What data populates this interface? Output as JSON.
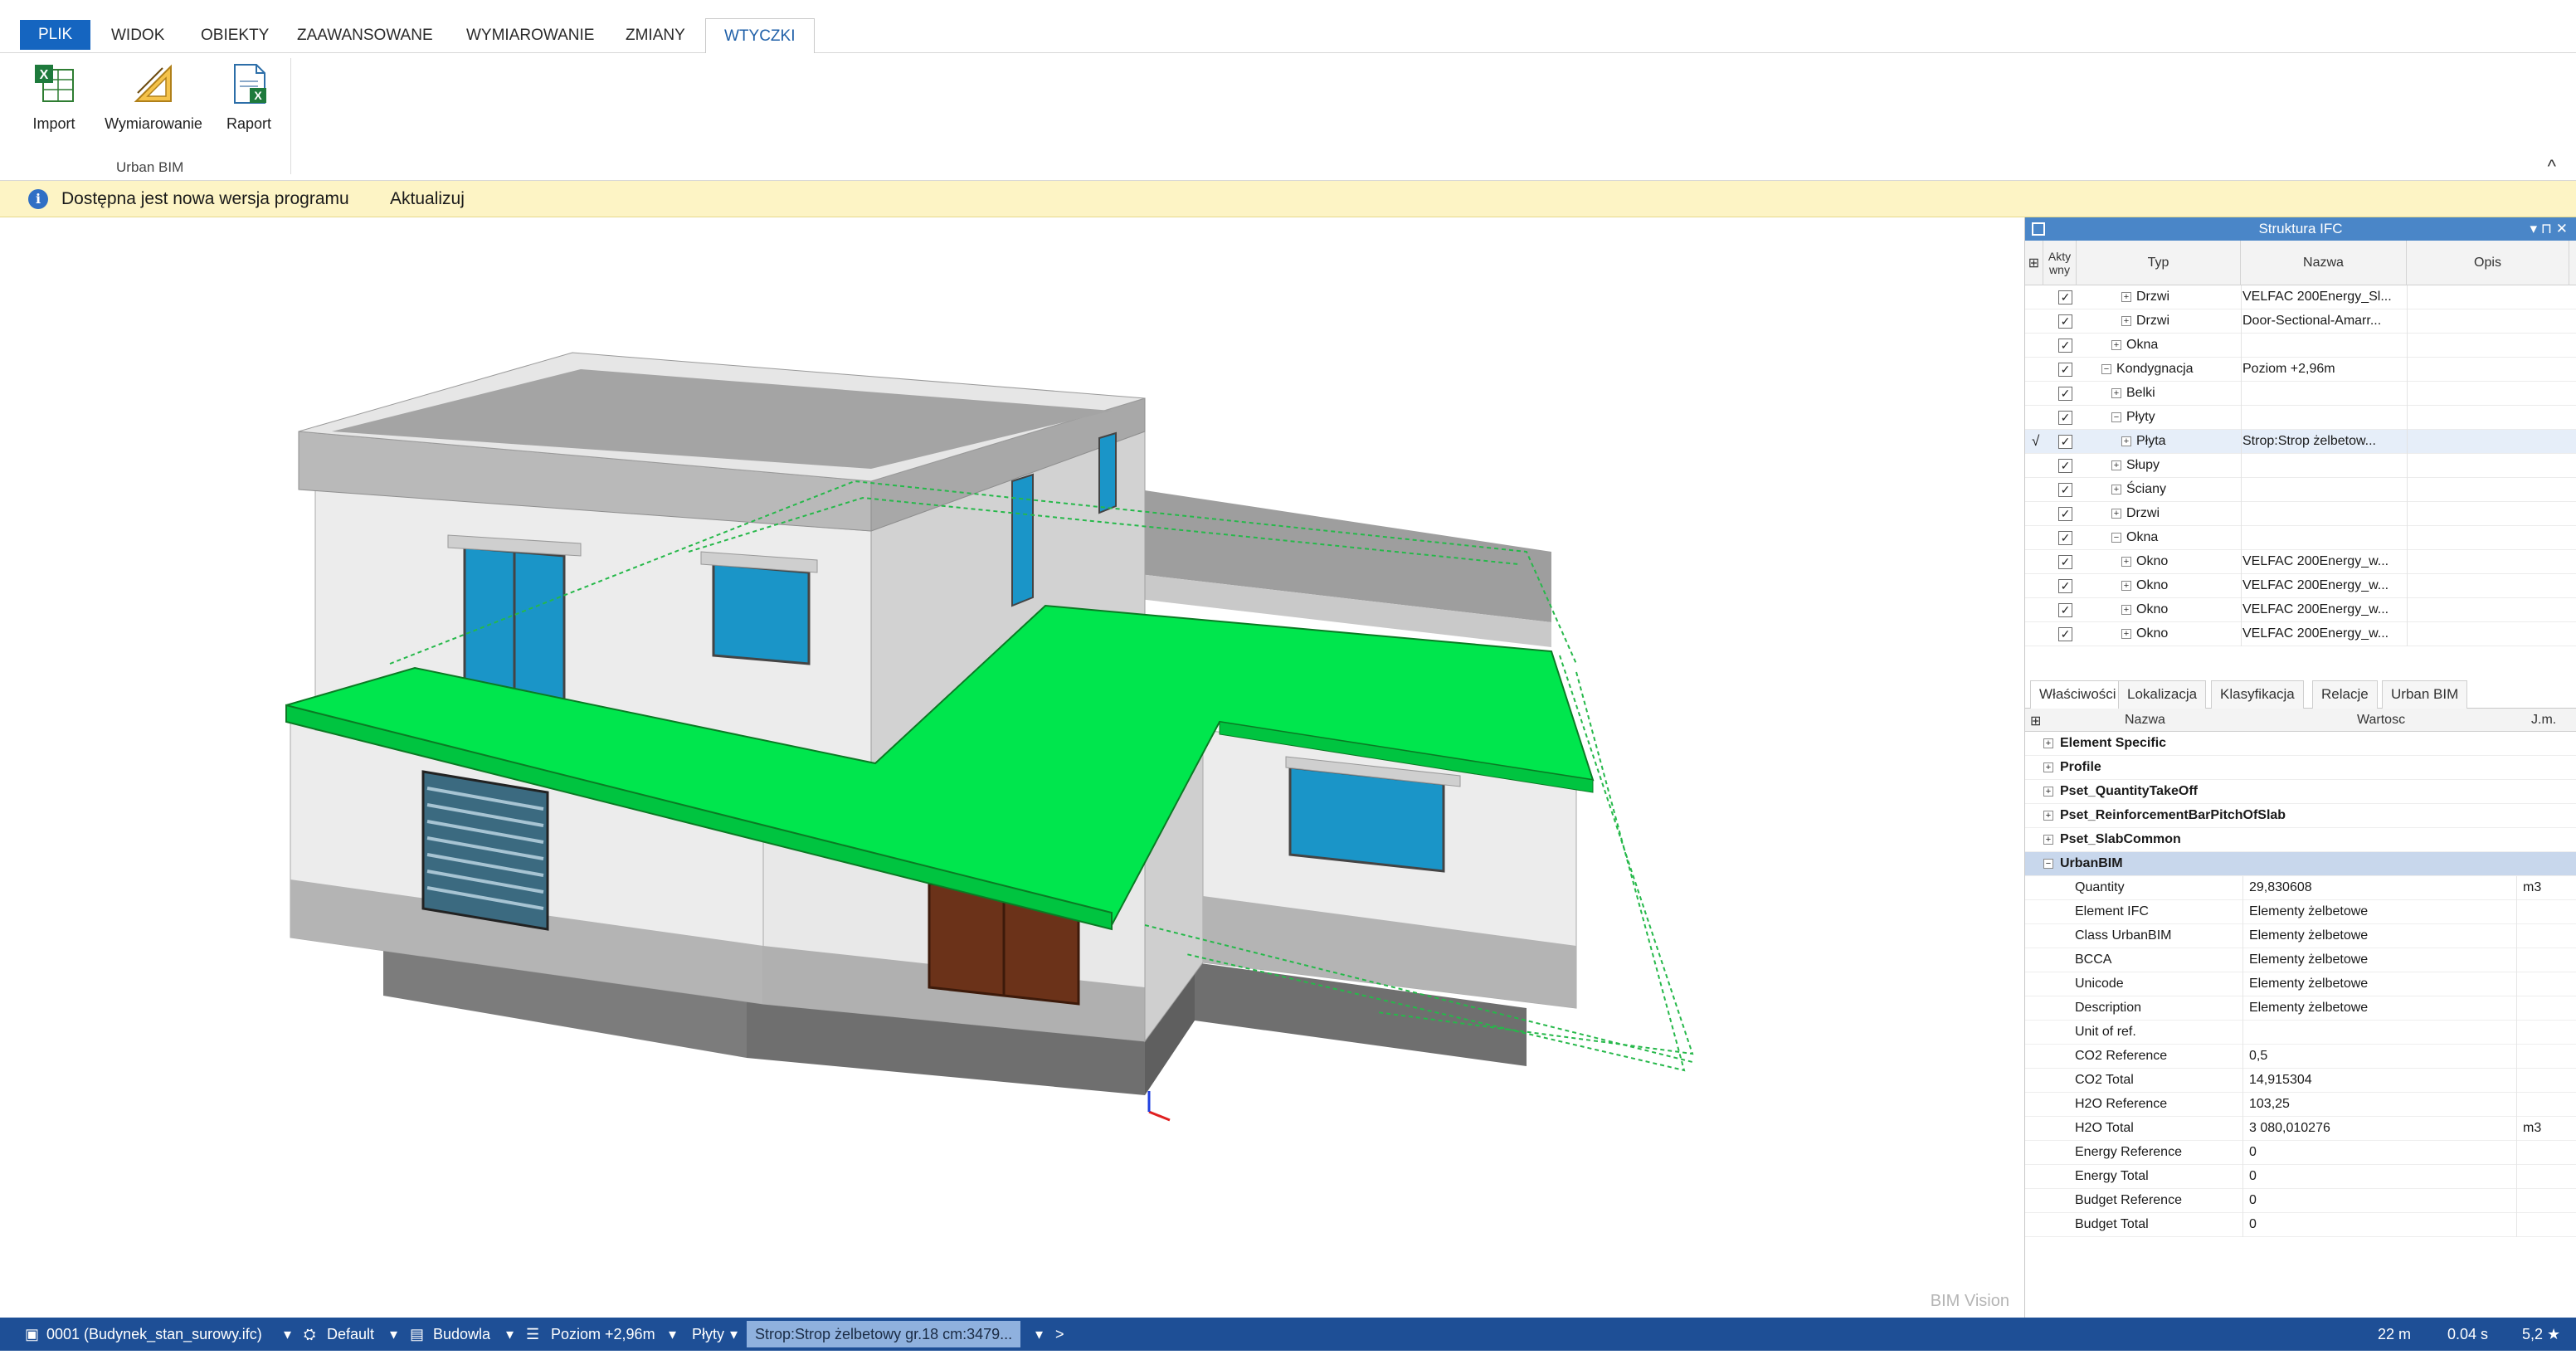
{
  "ribbon": {
    "tabs": [
      "PLIK",
      "WIDOK",
      "OBIEKTY",
      "ZAAWANSOWANE",
      "WYMIAROWANIE",
      "ZMIANY",
      "WTYCZKI"
    ],
    "active_tab": "WTYCZKI",
    "buttons": {
      "import": "Import",
      "dimensioning": "Wymiarowanie",
      "report": "Raport"
    },
    "group_label": "Urban BIM",
    "collapse_glyph": "^"
  },
  "notification": {
    "message": "Dostępna jest nowa wersja programu",
    "action": "Aktualizuj",
    "icon": "info-icon"
  },
  "viewport": {
    "watermark": "BIM Vision",
    "highlight_color": "#00e64d"
  },
  "ifc_panel": {
    "title": "Struktura IFC",
    "columns": {
      "active": "Akty wny",
      "type": "Typ",
      "name": "Nazwa",
      "desc": "Opis"
    },
    "rows": [
      {
        "type": "Drzwi",
        "name": "VELFAC 200Energy_Sl...",
        "level": 3,
        "expander": "+",
        "selected": false
      },
      {
        "type": "Drzwi",
        "name": "Door-Sectional-Amarr...",
        "level": 3,
        "expander": "+",
        "selected": false
      },
      {
        "type": "Okna",
        "name": "",
        "level": 2,
        "expander": "+",
        "selected": false
      },
      {
        "type": "Kondygnacja",
        "name": "Poziom +2,96m",
        "level": 1,
        "expander": "−",
        "selected": false
      },
      {
        "type": "Belki",
        "name": "",
        "level": 2,
        "expander": "+",
        "selected": false
      },
      {
        "type": "Płyty",
        "name": "",
        "level": 2,
        "expander": "−",
        "selected": false
      },
      {
        "type": "Płyta",
        "name": "Strop:Strop żelbetow...",
        "level": 3,
        "expander": "+",
        "selected": true
      },
      {
        "type": "Słupy",
        "name": "",
        "level": 2,
        "expander": "+",
        "selected": false
      },
      {
        "type": "Ściany",
        "name": "",
        "level": 2,
        "expander": "+",
        "selected": false
      },
      {
        "type": "Drzwi",
        "name": "",
        "level": 2,
        "expander": "+",
        "selected": false
      },
      {
        "type": "Okna",
        "name": "",
        "level": 2,
        "expander": "−",
        "selected": false
      },
      {
        "type": "Okno",
        "name": "VELFAC 200Energy_w...",
        "level": 3,
        "expander": "+",
        "selected": false
      },
      {
        "type": "Okno",
        "name": "VELFAC 200Energy_w...",
        "level": 3,
        "expander": "+",
        "selected": false
      },
      {
        "type": "Okno",
        "name": "VELFAC 200Energy_w...",
        "level": 3,
        "expander": "+",
        "selected": false
      },
      {
        "type": "Okno",
        "name": "VELFAC 200Energy_w...",
        "level": 3,
        "expander": "+",
        "selected": false
      }
    ],
    "check_glyph": "✓",
    "selected_marker": "√"
  },
  "props_panel": {
    "tabs": [
      "Właściwości",
      "Lokalizacja",
      "Klasyfikacja",
      "Relacje",
      "Urban BIM"
    ],
    "active_tab": "Właściwości",
    "columns": {
      "name": "Nazwa",
      "value": "Wartosc",
      "unit": "J.m."
    },
    "groups": [
      {
        "name": "Element Specific",
        "open": false
      },
      {
        "name": "Profile",
        "open": false
      },
      {
        "name": "Pset_QuantityTakeOff",
        "open": false
      },
      {
        "name": "Pset_ReinforcementBarPitchOfSlab",
        "open": false
      },
      {
        "name": "Pset_SlabCommon",
        "open": false
      },
      {
        "name": "UrbanBIM",
        "open": true
      }
    ],
    "properties": [
      {
        "name": "Quantity",
        "value": "29,830608",
        "unit": "m3"
      },
      {
        "name": "Element IFC",
        "value": "Elementy żelbetowe",
        "unit": ""
      },
      {
        "name": "Class UrbanBIM",
        "value": "Elementy żelbetowe",
        "unit": ""
      },
      {
        "name": "BCCA",
        "value": "Elementy żelbetowe",
        "unit": ""
      },
      {
        "name": "Unicode",
        "value": "Elementy żelbetowe",
        "unit": ""
      },
      {
        "name": "Description",
        "value": "Elementy żelbetowe",
        "unit": ""
      },
      {
        "name": "Unit of ref.",
        "value": "",
        "unit": ""
      },
      {
        "name": "CO2 Reference",
        "value": "0,5",
        "unit": ""
      },
      {
        "name": "CO2 Total",
        "value": "14,915304",
        "unit": ""
      },
      {
        "name": "H2O Reference",
        "value": "103,25",
        "unit": ""
      },
      {
        "name": "H2O Total",
        "value": "3 080,010276",
        "unit": "m3"
      },
      {
        "name": "Energy Reference",
        "value": "0",
        "unit": ""
      },
      {
        "name": "Energy Total",
        "value": "0",
        "unit": ""
      },
      {
        "name": "Budget Reference",
        "value": "0",
        "unit": ""
      },
      {
        "name": "Budget Total",
        "value": "0",
        "unit": ""
      }
    ]
  },
  "statusbar": {
    "file": "0001 (Budynek_stan_surowy.ifc)",
    "view": "Default",
    "building": "Budowla",
    "level": "Poziom +2,96m",
    "category": "Płyty",
    "selection": "Strop:Strop żelbetowy gr.18 cm:3479...",
    "next": ">",
    "distance": "22 m",
    "time": "0.04 s",
    "zoom": "5,2 ★"
  }
}
